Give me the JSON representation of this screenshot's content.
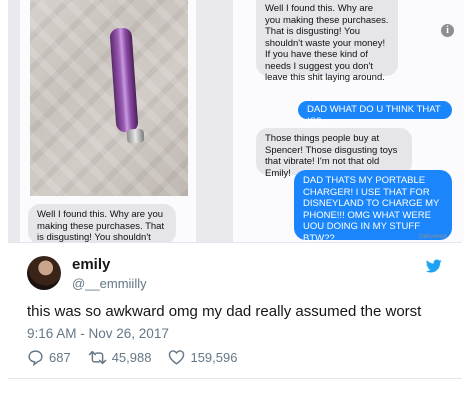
{
  "screenshot": {
    "left_bubble": "Well I found this. Why are you making these purchases. That is disgusting! You shouldn't waste",
    "messages": [
      {
        "from": "dad",
        "text": "Well I found this. Why are you making these purchases. That is disgusting! You shouldn't waste your money! If you have these kind of needs I suggest you don't leave this shit laying around."
      },
      {
        "from": "me",
        "text": "DAD WHAT DO U THINK THAT IS?"
      },
      {
        "from": "dad",
        "text": "Those things people buy at Spencer! Those disgusting toys that vibrate! I'm not that old Emily!"
      },
      {
        "from": "me",
        "text": "DAD THATS MY PORTABLE CHARGER! I USE THAT FOR DISNEYLAND TO CHARGE MY PHONE!!! OMG WHAT WERE UOU DOING IN MY STUFF BTW??"
      }
    ],
    "delivered": "Delivered"
  },
  "tweet": {
    "name": "emily",
    "handle": "@__emmiilly",
    "text": "this was so awkward omg my dad really assumed the worst",
    "timestamp": "9:16 AM - Nov 26, 2017",
    "replies": "687",
    "retweets": "45,988",
    "likes": "159,596"
  },
  "colors": {
    "imessage_blue": "#1b86fb",
    "imessage_gray": "#e5e5ea",
    "twitter_blue": "#1da1f2",
    "muted": "#657786"
  },
  "icons": [
    "info-icon",
    "twitter-bird-icon",
    "reply-icon",
    "retweet-icon",
    "like-icon"
  ]
}
